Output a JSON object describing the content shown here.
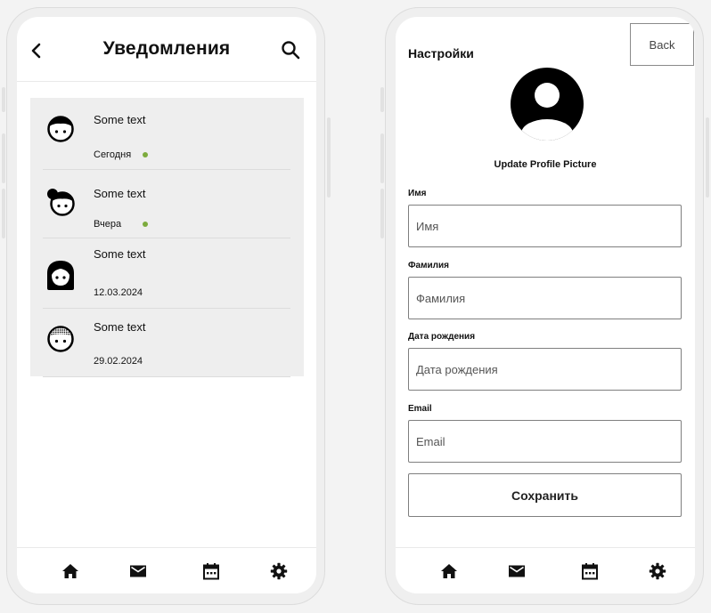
{
  "notifications_screen": {
    "title": "Уведомления",
    "items": [
      {
        "text": "Some text",
        "date": "Сегодня",
        "unread": true,
        "avatar": "boy-face-icon"
      },
      {
        "text": "Some text",
        "date": "Вчера",
        "unread": true,
        "avatar": "girl-bun-face-icon"
      },
      {
        "text": "Some text",
        "date": "12.03.2024",
        "unread": false,
        "avatar": "woman-long-hair-icon"
      },
      {
        "text": "Some text",
        "date": "29.02.2024",
        "unread": false,
        "avatar": "baby-face-icon"
      }
    ]
  },
  "settings_screen": {
    "title": "Настройки",
    "back_label": "Back",
    "update_picture_label": "Update Profile Picture",
    "fields": [
      {
        "label": "Имя",
        "placeholder": "Имя",
        "value": ""
      },
      {
        "label": "Фамилия",
        "placeholder": "Фамилия",
        "value": ""
      },
      {
        "label": "Дата рождения",
        "placeholder": "Дата рождения",
        "value": ""
      },
      {
        "label": "Email",
        "placeholder": "Email",
        "value": ""
      }
    ],
    "save_label": "Сохранить"
  },
  "bottom_nav": [
    "home-icon",
    "mail-icon",
    "calendar-icon",
    "settings-gear-icon"
  ],
  "colors": {
    "unread_dot": "#7cab3d",
    "list_background": "#eeeeee",
    "page_background": "#f3f3f3"
  }
}
